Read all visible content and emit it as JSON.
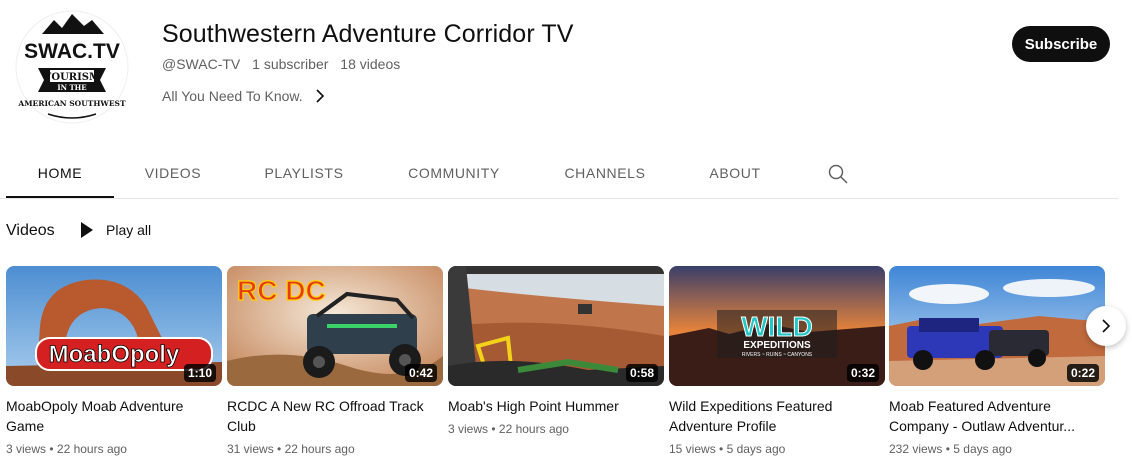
{
  "channel": {
    "title": "Southwestern Adventure Corridor TV",
    "handle": "@SWAC-TV",
    "subscribers": "1 subscriber",
    "video_count": "18 videos",
    "tagline": "All You Need To Know.",
    "subscribe_label": "Subscribe",
    "logo": {
      "main_text": "SWAC.TV",
      "banner_text": "TOURISM",
      "sub1": "IN THE",
      "sub2": "AMERICAN SOUTHWEST"
    }
  },
  "tabs": [
    {
      "label": "HOME",
      "active": true
    },
    {
      "label": "VIDEOS",
      "active": false
    },
    {
      "label": "PLAYLISTS",
      "active": false
    },
    {
      "label": "COMMUNITY",
      "active": false
    },
    {
      "label": "CHANNELS",
      "active": false
    },
    {
      "label": "ABOUT",
      "active": false
    }
  ],
  "section": {
    "title": "Videos",
    "play_all": "Play all"
  },
  "videos": [
    {
      "title": "MoabOpoly Moab Adventure Game",
      "duration": "1:10",
      "views": "3 views",
      "age": "22 hours ago",
      "thumb_text": "MoabOpoly"
    },
    {
      "title": "RCDC A New RC Offroad Track Club",
      "duration": "0:42",
      "views": "31 views",
      "age": "22 hours ago",
      "thumb_text": "RC DC"
    },
    {
      "title": "Moab's High Point Hummer",
      "duration": "0:58",
      "views": "3 views",
      "age": "22 hours ago",
      "thumb_text": ""
    },
    {
      "title": "Wild Expeditions Featured Adventure Profile",
      "duration": "0:32",
      "views": "15 views",
      "age": "5 days ago",
      "thumb_text": "WILD",
      "thumb_sub": "EXPEDITIONS",
      "thumb_sub2": "RIVERS ~ RUINS ~ CANYONS"
    },
    {
      "title": "Moab Featured Adventure Company - Outlaw Adventur...",
      "duration": "0:22",
      "views": "232 views",
      "age": "5 days ago",
      "thumb_text": ""
    }
  ],
  "meta_separator": "•"
}
